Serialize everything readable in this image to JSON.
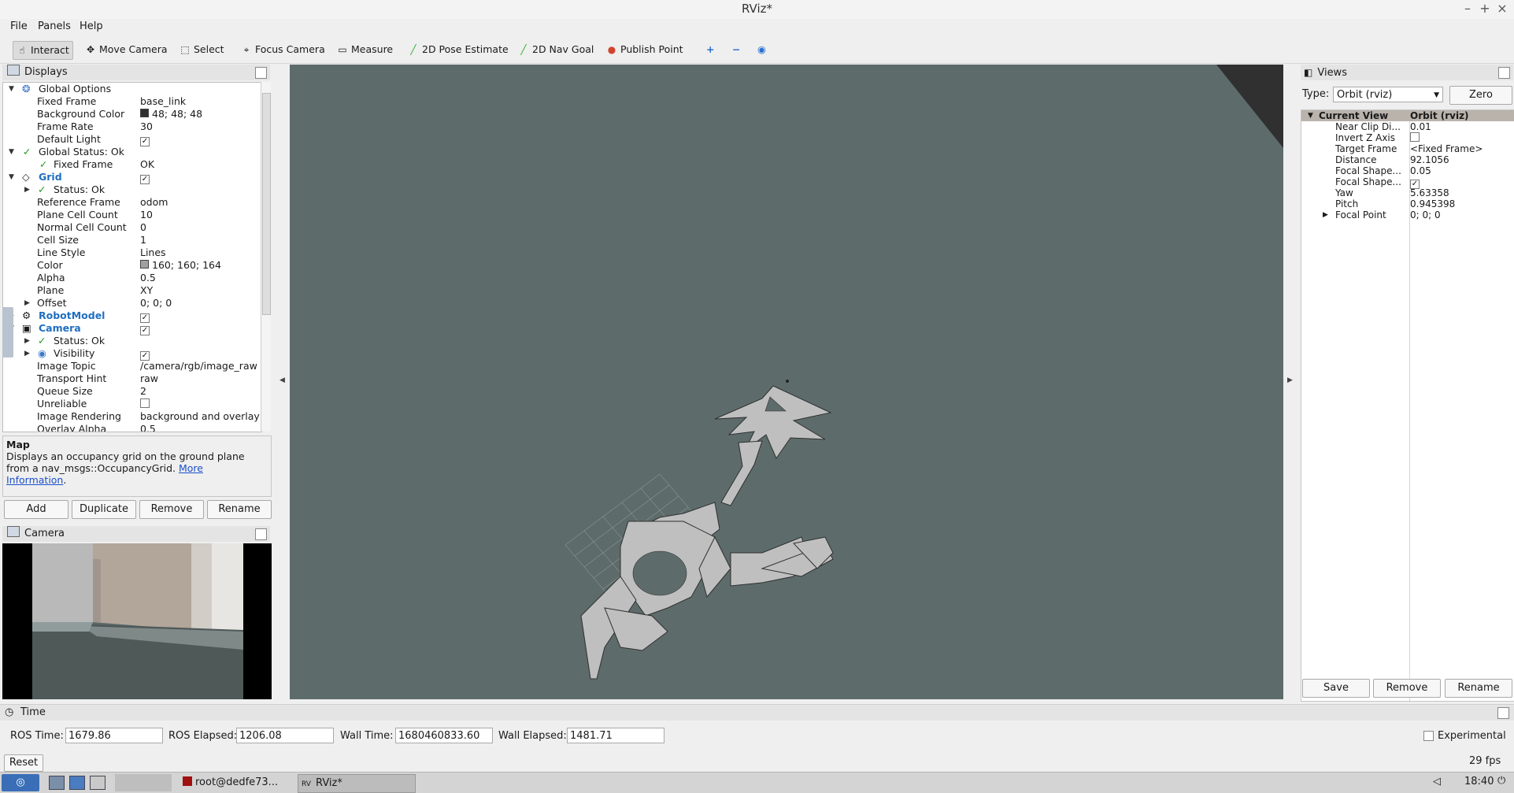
{
  "window": {
    "title": "RViz*"
  },
  "menu": [
    "File",
    "Panels",
    "Help"
  ],
  "toolbar": {
    "interact": "Interact",
    "move_camera": "Move Camera",
    "select": "Select",
    "focus_camera": "Focus Camera",
    "measure": "Measure",
    "pose_estimate": "2D Pose Estimate",
    "nav_goal": "2D Nav Goal",
    "publish_point": "Publish Point"
  },
  "displays": {
    "title": "Displays",
    "rows": [
      {
        "name": "Global Options",
        "value": ""
      },
      {
        "name": "Fixed Frame",
        "value": "base_link"
      },
      {
        "name": "Background Color",
        "value": "48; 48; 48"
      },
      {
        "name": "Frame Rate",
        "value": "30"
      },
      {
        "name": "Default Light",
        "value": ""
      },
      {
        "name": "Global Status: Ok",
        "value": ""
      },
      {
        "name": "Fixed Frame",
        "value": "OK"
      },
      {
        "name": "Grid",
        "value": ""
      },
      {
        "name": "Status: Ok",
        "value": ""
      },
      {
        "name": "Reference Frame",
        "value": "odom"
      },
      {
        "name": "Plane Cell Count",
        "value": "10"
      },
      {
        "name": "Normal Cell Count",
        "value": "0"
      },
      {
        "name": "Cell Size",
        "value": "1"
      },
      {
        "name": "Line Style",
        "value": "Lines"
      },
      {
        "name": "Color",
        "value": "160; 160; 164"
      },
      {
        "name": "Alpha",
        "value": "0.5"
      },
      {
        "name": "Plane",
        "value": "XY"
      },
      {
        "name": "Offset",
        "value": "0; 0; 0"
      },
      {
        "name": "RobotModel",
        "value": ""
      },
      {
        "name": "Camera",
        "value": ""
      },
      {
        "name": "Status: Ok",
        "value": ""
      },
      {
        "name": "Visibility",
        "value": ""
      },
      {
        "name": "Image Topic",
        "value": "/camera/rgb/image_raw"
      },
      {
        "name": "Transport Hint",
        "value": "raw"
      },
      {
        "name": "Queue Size",
        "value": "2"
      },
      {
        "name": "Unreliable",
        "value": ""
      },
      {
        "name": "Image Rendering",
        "value": "background and overlay"
      },
      {
        "name": "Overlay Alpha",
        "value": "0.5"
      }
    ],
    "desc_title": "Map",
    "desc_text": "Displays an occupancy grid on the ground plane from a nav_msgs::OccupancyGrid.",
    "desc_link": "More Information",
    "desc_end": ".",
    "buttons": {
      "add": "Add",
      "duplicate": "Duplicate",
      "remove": "Remove",
      "rename": "Rename"
    }
  },
  "camera_panel": {
    "title": "Camera"
  },
  "views": {
    "title": "Views",
    "type_label": "Type:",
    "type_value": "Orbit (rviz)",
    "zero": "Zero",
    "current_view": "Current View",
    "current_view_type": "Orbit (rviz)",
    "props": [
      {
        "name": "Near Clip Di...",
        "value": "0.01"
      },
      {
        "name": "Invert Z Axis",
        "value": ""
      },
      {
        "name": "Target Frame",
        "value": "<Fixed Frame>"
      },
      {
        "name": "Distance",
        "value": "92.1056"
      },
      {
        "name": "Focal Shape...",
        "value": "0.05"
      },
      {
        "name": "Focal Shape...",
        "value": ""
      },
      {
        "name": "Yaw",
        "value": "5.63358"
      },
      {
        "name": "Pitch",
        "value": "0.945398"
      },
      {
        "name": "Focal Point",
        "value": "0; 0; 0"
      }
    ],
    "buttons": {
      "save": "Save",
      "remove": "Remove",
      "rename": "Rename"
    }
  },
  "time": {
    "title": "Time",
    "ros_time_label": "ROS Time:",
    "ros_time": "1679.86",
    "ros_elapsed_label": "ROS Elapsed:",
    "ros_elapsed": "1206.08",
    "wall_time_label": "Wall Time:",
    "wall_time": "1680460833.60",
    "wall_elapsed_label": "Wall Elapsed:",
    "wall_elapsed": "1481.71",
    "experimental": "Experimental",
    "reset": "Reset",
    "fps": "29 fps"
  },
  "taskbar": {
    "terminal": "root@dedfe73...",
    "rviz": "RViz*",
    "clock": "18:40"
  }
}
